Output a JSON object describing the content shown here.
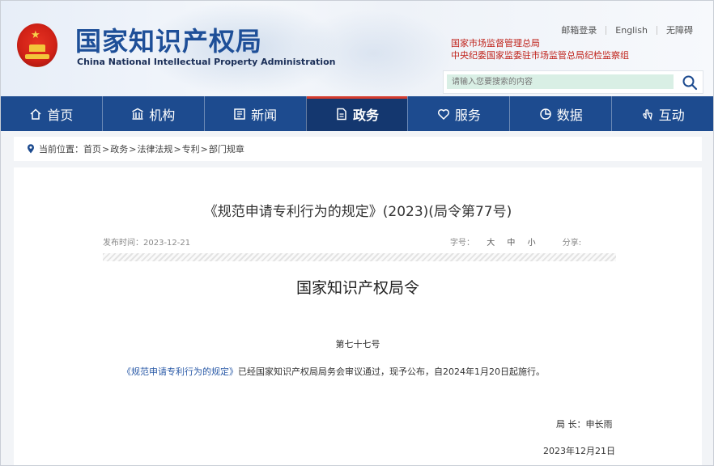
{
  "header": {
    "logo_cn": "国家知识产权局",
    "logo_en": "China National Intellectual Property Administration",
    "top_links": [
      "邮箱登录",
      "English",
      "无障碍"
    ],
    "related_links": [
      "国家市场监督管理总局",
      "中央纪委国家监委驻市场监管总局纪检监察组"
    ],
    "search_placeholder": "请输入您要搜索的内容"
  },
  "nav": {
    "items": [
      {
        "label": "首页",
        "icon": "home-icon"
      },
      {
        "label": "机构",
        "icon": "building-icon"
      },
      {
        "label": "新闻",
        "icon": "news-icon"
      },
      {
        "label": "政务",
        "icon": "document-icon",
        "active": true
      },
      {
        "label": "服务",
        "icon": "service-icon"
      },
      {
        "label": "数据",
        "icon": "chart-icon"
      },
      {
        "label": "互动",
        "icon": "hand-icon"
      }
    ],
    "active_color": "#14376f",
    "bar_color": "#1d4b8f"
  },
  "breadcrumb": {
    "prefix": "当前位置：",
    "items": [
      "首页",
      "政务",
      "法律法规",
      "专利",
      "部门规章"
    ],
    "separator": ">"
  },
  "article": {
    "title": "《规范申请专利行为的规定》(2023)(局令第77号)",
    "publish_label": "发布时间：",
    "publish_date": "2023-12-21",
    "font_size_label": "字号：",
    "font_sizes": [
      "大",
      "中",
      "小"
    ],
    "share_label": "分享:",
    "subhead": "国家知识产权局令",
    "order_no": "第七十七号",
    "para_link": "《规范申请专利行为的规定》",
    "para_text": "已经国家知识产权局局务会审议通过，现予公布，自2024年1月20日起施行。",
    "signature": "局 长：申长雨",
    "date": "2023年12月21日"
  }
}
